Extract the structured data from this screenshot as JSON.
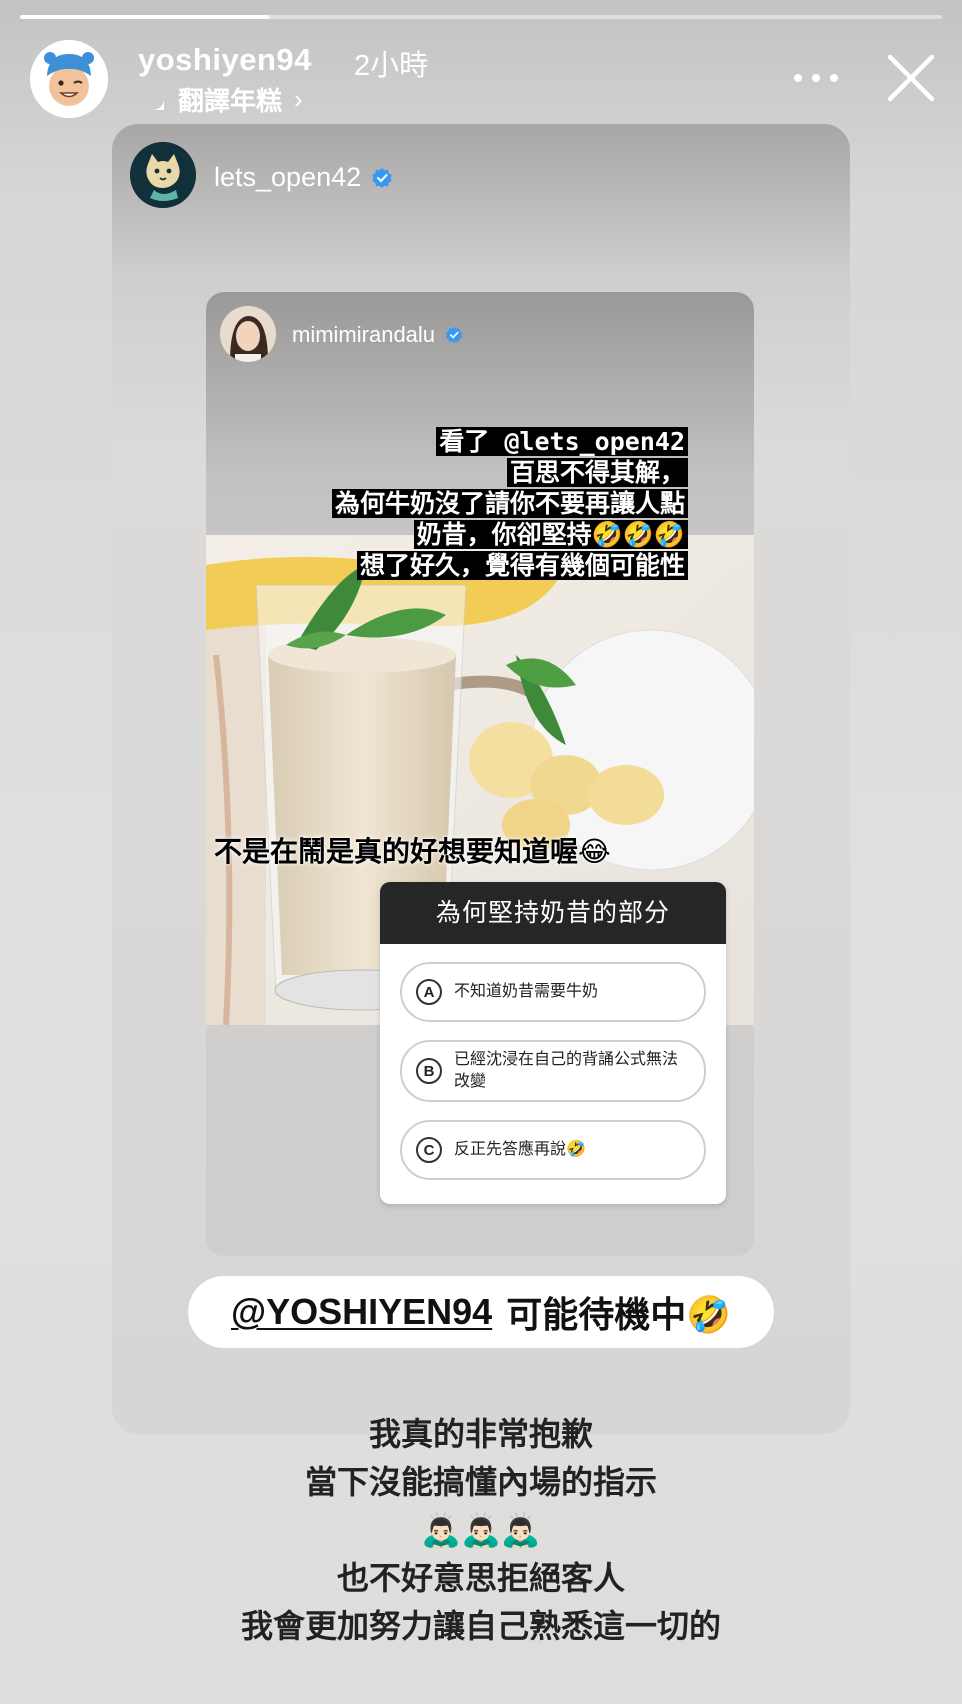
{
  "story": {
    "progress": 0.27,
    "username": "yoshiyen94",
    "time": "2小時",
    "translate_label": "翻譯年糕",
    "translate_chevron": "›"
  },
  "shared_post": {
    "username": "lets_open42",
    "inner_story": {
      "username": "mimimirandalu",
      "caption_lines": [
        "看了 @lets_open42",
        "百思不得其解，",
        "為何牛奶沒了請你不要再讓人點",
        "奶昔，你卻堅持🤣🤣🤣",
        "想了好久，覺得有幾個可能性"
      ],
      "overlay_text": "不是在鬧是真的好想要知道喔😂",
      "quiz": {
        "question": "為何堅持奶昔的部分",
        "options": [
          {
            "letter": "A",
            "text": "不知道奶昔需要牛奶"
          },
          {
            "letter": "B",
            "text": "已經沈浸在自己的背誦公式無法改變"
          },
          {
            "letter": "C",
            "text": "反正先答應再說🤣"
          }
        ]
      }
    },
    "mention": {
      "handle": "@YOSHIYEN94",
      "text": "可能待機中🤣"
    }
  },
  "bottom_text": {
    "line1": "我真的非常抱歉",
    "line2": "當下沒能搞懂內場的指示",
    "emojis": "🙇🏻‍♂️🙇🏻‍♂️🙇🏻‍♂️",
    "line3": "也不好意思拒絕客人",
    "line4": "我會更加努力讓自己熟悉這一切的"
  },
  "colors": {
    "verified": "#3897f0",
    "quiz_header": "#262626",
    "caption_bg": "#000000"
  }
}
